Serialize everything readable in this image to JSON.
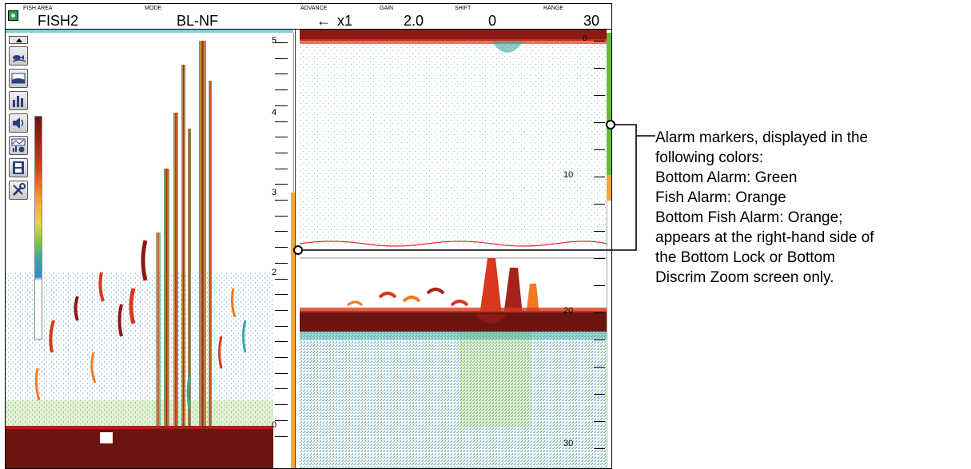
{
  "header": {
    "fish_area_label": "FISH AREA",
    "fish_area_value": "FISH2",
    "mode_label": "MODE",
    "mode_value": "BL-NF",
    "advance_label": "ADVANCE",
    "advance_value": "x1",
    "gain_label": "GAIN",
    "gain_value": "2.0",
    "shift_label": "SHIFT",
    "shift_value": "0",
    "range_label": "RANGE",
    "range_value": "30"
  },
  "toolbar": {
    "items": [
      {
        "icon": "fish-mode-icon"
      },
      {
        "icon": "bottom-icon"
      },
      {
        "icon": "histogram-icon"
      },
      {
        "icon": "speaker-icon"
      },
      {
        "icon": "analysis-icon"
      },
      {
        "icon": "film-icon"
      },
      {
        "icon": "tools-icon"
      }
    ]
  },
  "left_scale": {
    "labels": [
      "5",
      "4",
      "3",
      "2",
      "0"
    ]
  },
  "right_scale": {
    "labels": [
      "0",
      "10",
      "20",
      "30"
    ]
  },
  "annotation": {
    "lines": [
      "Alarm markers, displayed in the",
      "following colors:",
      "Bottom Alarm: Green",
      "Fish Alarm: Orange",
      "Bottom Fish Alarm: Orange;",
      "appears at the right-hand side of",
      "the Bottom Lock or Bottom",
      "Discrim Zoom screen only."
    ]
  },
  "colors": {
    "alarm_green": "#6ab93b",
    "alarm_orange": "#f2a93b",
    "bottom_echo": "#6b1410",
    "fish_echo": "#d9381e",
    "noise": "#3aa9a0"
  }
}
